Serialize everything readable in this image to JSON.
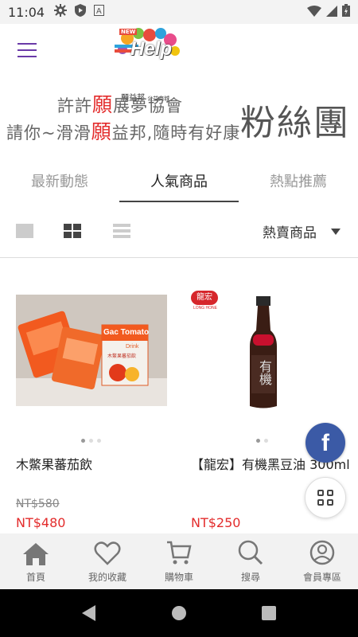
{
  "status_bar": {
    "time": "11:04",
    "icons": [
      "gear-icon",
      "shield-icon",
      "a-icon",
      "wifi-icon",
      "signal-icon",
      "battery-icon"
    ]
  },
  "header": {
    "logo_word": "Help",
    "logo_badge": "NEW",
    "logo_name": "願益邦",
    "logo_tagline": "公益商城"
  },
  "banner": {
    "line1_a": "許許",
    "line1_hl": "願",
    "line1_b": "展夢協會",
    "line2_a": "請你~滑滑",
    "line2_hl": "願",
    "line2_b": "益邦,隨時有好康",
    "side": "粉絲團"
  },
  "tabs": [
    {
      "label": "最新動態",
      "active": false
    },
    {
      "label": "人氣商品",
      "active": true
    },
    {
      "label": "熱點推薦",
      "active": false
    }
  ],
  "toolbar": {
    "sort_label": "熱賣商品"
  },
  "products": [
    {
      "name": "木鱉果蕃茄飲",
      "old_price": "NT$580",
      "price": "NT$480",
      "pkg_title": "Gac Tomato",
      "pkg_sub": "Drink",
      "pkg_cn": "木鱉果蕃茄飲"
    },
    {
      "name": "【龍宏】有機黑豆油 300ml",
      "old_price": "",
      "price": "NT$250",
      "brand": "龍宏",
      "brand_en": "LONG HONE",
      "bottle_label": "有機"
    }
  ],
  "floating": {
    "facebook_glyph": "f"
  },
  "bottom_nav": [
    {
      "label": "首頁",
      "icon": "home-icon"
    },
    {
      "label": "我的收藏",
      "icon": "heart-icon"
    },
    {
      "label": "購物車",
      "icon": "cart-icon"
    },
    {
      "label": "搜尋",
      "icon": "search-icon"
    },
    {
      "label": "會員專區",
      "icon": "user-icon"
    }
  ],
  "colors": {
    "accent_red": "#e32c2c",
    "menu_purple": "#6a3aa8",
    "facebook_blue": "#3b5aa6"
  }
}
